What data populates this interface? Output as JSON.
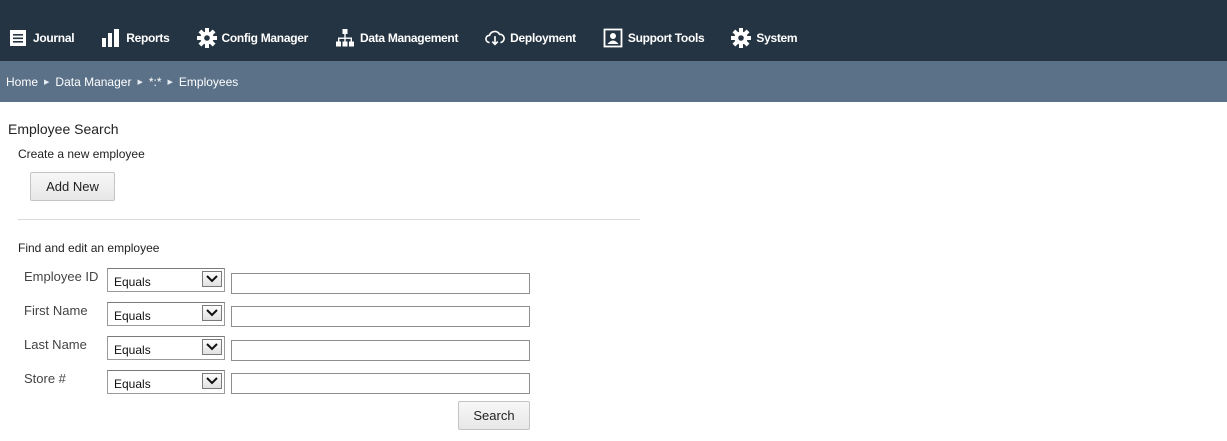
{
  "nav": {
    "items": [
      {
        "label": "Journal",
        "icon": "journal-icon"
      },
      {
        "label": "Reports",
        "icon": "bar-chart-icon"
      },
      {
        "label": "Config Manager",
        "icon": "gear-icon"
      },
      {
        "label": "Data Management",
        "icon": "sitemap-icon"
      },
      {
        "label": "Deployment",
        "icon": "cloud-download-icon"
      },
      {
        "label": "Support Tools",
        "icon": "support-icon"
      },
      {
        "label": "System",
        "icon": "gear-icon"
      }
    ]
  },
  "breadcrumb": [
    "Home",
    "Data Manager",
    "*:*",
    "Employees"
  ],
  "page": {
    "title": "Employee Search",
    "create_label": "Create a new employee",
    "add_new_label": "Add New",
    "find_label": "Find and edit an employee",
    "search_label": "Search"
  },
  "fields": [
    {
      "label": "Employee ID",
      "operator": "Equals",
      "value": ""
    },
    {
      "label": "First Name",
      "operator": "Equals",
      "value": ""
    },
    {
      "label": "Last Name",
      "operator": "Equals",
      "value": ""
    },
    {
      "label": "Store #",
      "operator": "Equals",
      "value": ""
    }
  ],
  "colors": {
    "nav_bg": "#253442",
    "crumb_bg": "#5a7188"
  }
}
